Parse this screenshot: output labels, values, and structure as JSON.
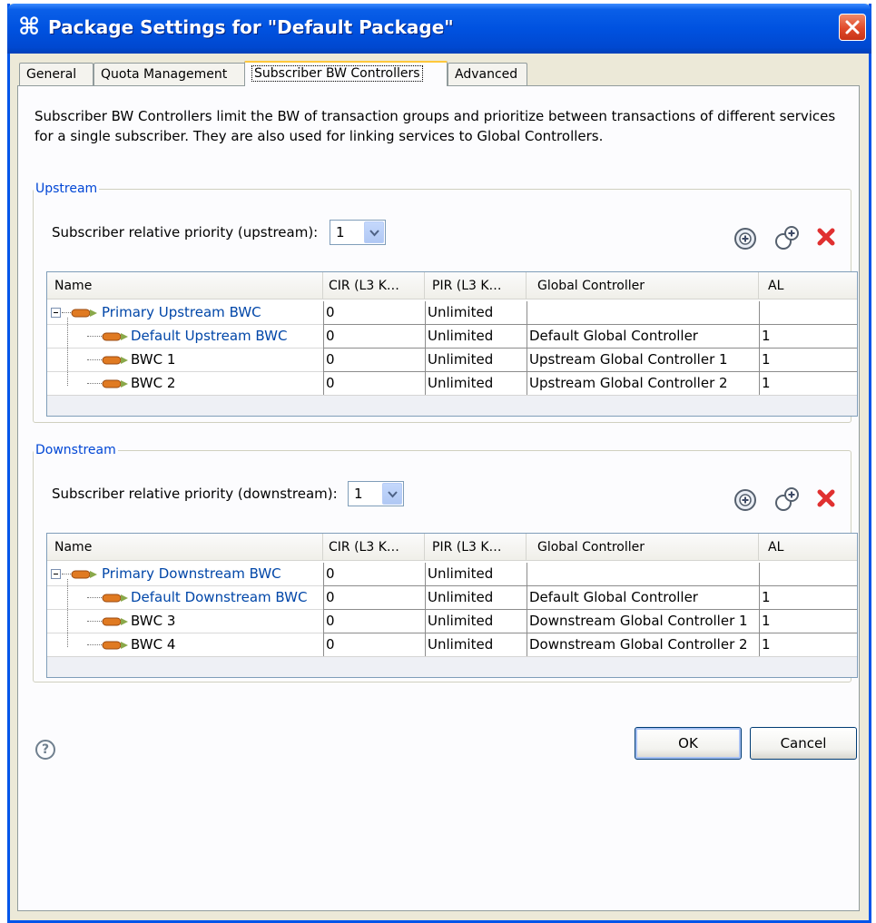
{
  "window": {
    "title": "Package Settings for \"Default Package\"",
    "icon": "package-settings-icon",
    "accent_color": "#0055ea"
  },
  "tabs": [
    {
      "label": "General",
      "active": false
    },
    {
      "label": "Quota Management",
      "active": false
    },
    {
      "label": "Subscriber BW Controllers",
      "active": true
    },
    {
      "label": "Advanced",
      "active": false
    }
  ],
  "description": "Subscriber BW Controllers limit the BW of transaction groups and prioritize between transactions of different services for a single subscriber. They are also used for linking services to Global Controllers.",
  "columns": [
    "Name",
    "CIR (L3 K…",
    "PIR (L3 K…",
    "Global Controller",
    "AL"
  ],
  "upstream": {
    "title": "Upstream",
    "priority_label": "Subscriber relative priority (upstream):",
    "priority_value": "1",
    "rows": [
      {
        "name": "Primary Upstream BWC",
        "cir": "0",
        "pir": "Unlimited",
        "gc": "",
        "al": "",
        "level": 0,
        "link": true
      },
      {
        "name": "Default Upstream BWC",
        "cir": "0",
        "pir": "Unlimited",
        "gc": "Default Global Controller",
        "al": "1",
        "level": 1,
        "link": true
      },
      {
        "name": "BWC 1",
        "cir": "0",
        "pir": "Unlimited",
        "gc": "Upstream Global Controller 1",
        "al": "1",
        "level": 1,
        "link": false
      },
      {
        "name": "BWC 2",
        "cir": "0",
        "pir": "Unlimited",
        "gc": "Upstream Global Controller 2",
        "al": "1",
        "level": 1,
        "link": false
      }
    ]
  },
  "downstream": {
    "title": "Downstream",
    "priority_label": "Subscriber relative priority (downstream):",
    "priority_value": "1",
    "rows": [
      {
        "name": "Primary Downstream BWC",
        "cir": "0",
        "pir": "Unlimited",
        "gc": "",
        "al": "",
        "level": 0,
        "link": true
      },
      {
        "name": "Default Downstream BWC",
        "cir": "0",
        "pir": "Unlimited",
        "gc": "Default Global Controller",
        "al": "1",
        "level": 1,
        "link": true
      },
      {
        "name": "BWC 3",
        "cir": "0",
        "pir": "Unlimited",
        "gc": "Downstream Global Controller 1",
        "al": "1",
        "level": 1,
        "link": false
      },
      {
        "name": "BWC 4",
        "cir": "0",
        "pir": "Unlimited",
        "gc": "Downstream Global Controller 2",
        "al": "1",
        "level": 1,
        "link": false
      }
    ]
  },
  "buttons": {
    "ok": "OK",
    "cancel": "Cancel",
    "help": "?"
  }
}
